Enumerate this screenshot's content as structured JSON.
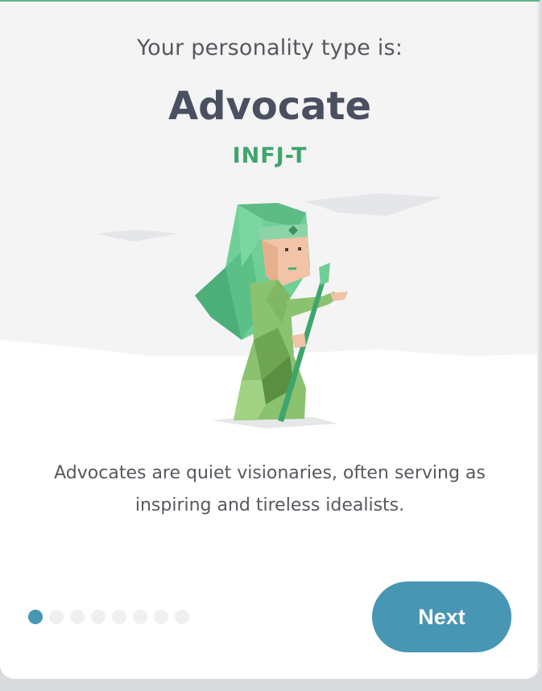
{
  "intro_text": "Your personality type is:",
  "type_name": "Advocate",
  "type_code": "INFJ-T",
  "description": "Advocates are quiet visionaries, often serving as inspiring and tireless idealists.",
  "pagination": {
    "total": 8,
    "current": 1
  },
  "next_label": "Next",
  "colors": {
    "accent": "#4796b3",
    "code_green": "#3fa56d",
    "title": "#4a5060"
  },
  "illustration_icon": "advocate-character-illustration"
}
